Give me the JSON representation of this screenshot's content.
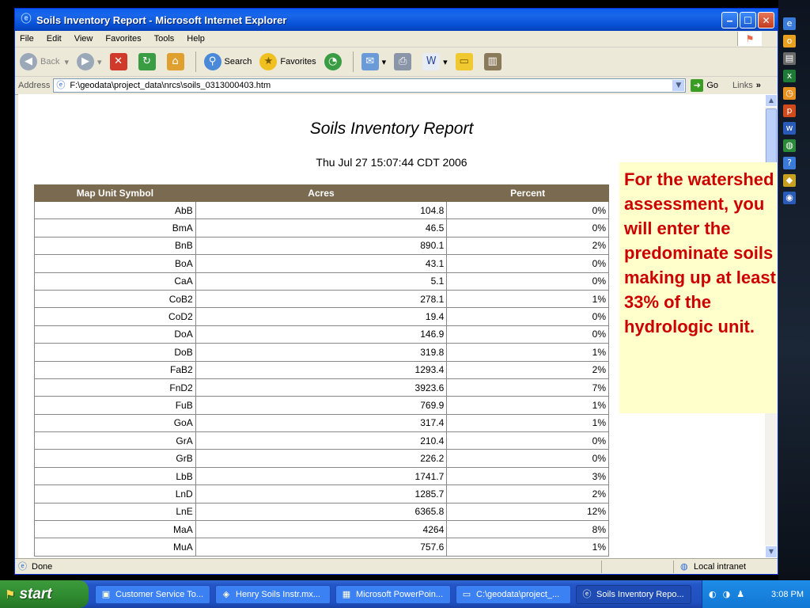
{
  "window": {
    "title": "Soils Inventory Report - Microsoft Internet Explorer",
    "minimize": "‒",
    "maximize": "☐",
    "close": "✕"
  },
  "menu": {
    "items": [
      "File",
      "Edit",
      "View",
      "Favorites",
      "Tools",
      "Help"
    ]
  },
  "toolbar": {
    "back_label": "Back",
    "search_label": "Search",
    "favorites_label": "Favorites"
  },
  "addressbar": {
    "label": "Address",
    "url": "F:\\geodata\\project_data\\nrcs\\soils_0313000403.htm",
    "go_label": "Go",
    "links_label": "Links",
    "links_chevron": "»"
  },
  "report": {
    "title": "Soils Inventory Report",
    "date": "Thu Jul 27 15:07:44 CDT 2006",
    "columns": [
      "Map Unit Symbol",
      "Acres",
      "Percent"
    ],
    "rows": [
      {
        "symbol": "AbB",
        "acres": "104.8",
        "percent": "0%"
      },
      {
        "symbol": "BmA",
        "acres": "46.5",
        "percent": "0%"
      },
      {
        "symbol": "BnB",
        "acres": "890.1",
        "percent": "2%"
      },
      {
        "symbol": "BoA",
        "acres": "43.1",
        "percent": "0%"
      },
      {
        "symbol": "CaA",
        "acres": "5.1",
        "percent": "0%"
      },
      {
        "symbol": "CoB2",
        "acres": "278.1",
        "percent": "1%"
      },
      {
        "symbol": "CoD2",
        "acres": "19.4",
        "percent": "0%"
      },
      {
        "symbol": "DoA",
        "acres": "146.9",
        "percent": "0%"
      },
      {
        "symbol": "DoB",
        "acres": "319.8",
        "percent": "1%"
      },
      {
        "symbol": "FaB2",
        "acres": "1293.4",
        "percent": "2%"
      },
      {
        "symbol": "FnD2",
        "acres": "3923.6",
        "percent": "7%"
      },
      {
        "symbol": "FuB",
        "acres": "769.9",
        "percent": "1%"
      },
      {
        "symbol": "GoA",
        "acres": "317.4",
        "percent": "1%"
      },
      {
        "symbol": "GrA",
        "acres": "210.4",
        "percent": "0%"
      },
      {
        "symbol": "GrB",
        "acres": "226.2",
        "percent": "0%"
      },
      {
        "symbol": "LbB",
        "acres": "1741.7",
        "percent": "3%"
      },
      {
        "symbol": "LnD",
        "acres": "1285.7",
        "percent": "2%"
      },
      {
        "symbol": "LnE",
        "acres": "6365.8",
        "percent": "12%"
      },
      {
        "symbol": "MaA",
        "acres": "4264",
        "percent": "8%"
      },
      {
        "symbol": "MuA",
        "acres": "757.6",
        "percent": "1%"
      }
    ]
  },
  "note": {
    "text": "For the watershed assessment, you will enter the predominate soils making up at least 33% of the hydrologic unit."
  },
  "statusbar": {
    "status": "Done",
    "zone": "Local intranet"
  },
  "taskbar": {
    "start_label": "start",
    "tasks": [
      "Customer Service To...",
      "Henry Soils Instr.mx...",
      "Microsoft PowerPoin...",
      "C:\\geodata\\project_...",
      "Soils Inventory Repo..."
    ],
    "clock": "3:08 PM"
  },
  "colors": {
    "table_header": "#7a6a4f",
    "note_text": "#cc0000",
    "note_background": "#ffffcc"
  }
}
